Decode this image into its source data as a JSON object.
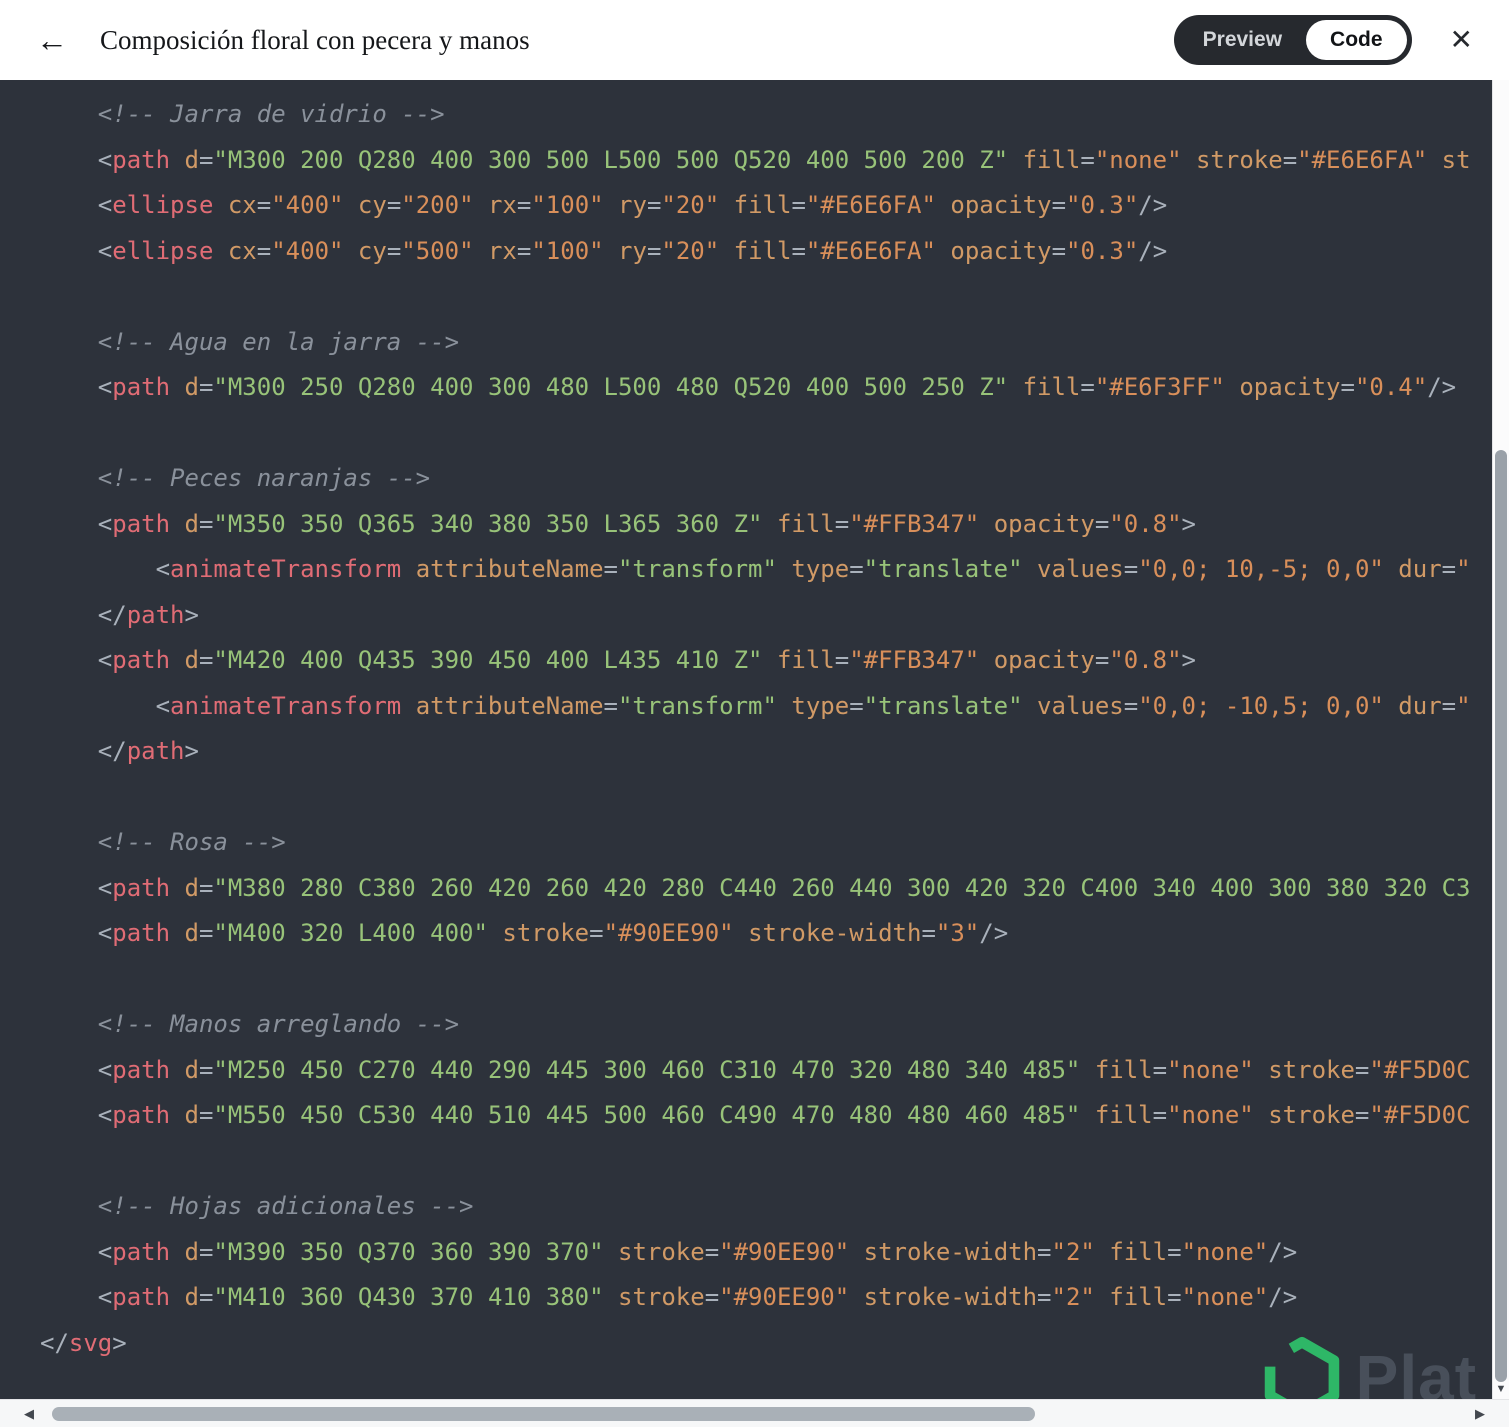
{
  "header": {
    "title": "Composición floral con pecera y manos",
    "toggle": {
      "preview_label": "Preview",
      "code_label": "Code",
      "selected": "Code"
    }
  },
  "icons": {
    "back": "←",
    "close": "✕",
    "scroll_left": "◀",
    "scroll_right": "▶",
    "scroll_down": "▼"
  },
  "watermark": {
    "text": "Plat",
    "logo_color": "#2fcf6f"
  },
  "colors": {
    "code_background": "#2d323b",
    "tag": "#e06c75",
    "attribute": "#d19a66",
    "string": "#98c379",
    "number_string": "#d98f5a",
    "comment": "#8a919b",
    "punctuation": "#a9b1bb",
    "toggle_pill": "#26292e",
    "toggle_active": "#ffffff"
  },
  "code": {
    "language": "svg",
    "token_types": {
      "c": "comment",
      "p": "punctuation",
      "t": "tag",
      "a": "attribute",
      "s": "string",
      "n": "numeric-string",
      "w": "whitespace"
    },
    "lines": [
      [
        [
          "c",
          "    <!-- Jarra de vidrio -->"
        ]
      ],
      [
        [
          "p",
          "    <"
        ],
        [
          "t",
          "path"
        ],
        [
          "w",
          " "
        ],
        [
          "a",
          "d"
        ],
        [
          "p",
          "="
        ],
        [
          "s",
          "\"M300 200 Q280 400 300 500 L500 500 Q520 400 500 200 Z\""
        ],
        [
          "w",
          " "
        ],
        [
          "a",
          "fill"
        ],
        [
          "p",
          "="
        ],
        [
          "n",
          "\"none\""
        ],
        [
          "w",
          " "
        ],
        [
          "a",
          "stroke"
        ],
        [
          "p",
          "="
        ],
        [
          "n",
          "\"#E6E6FA\""
        ],
        [
          "w",
          " "
        ],
        [
          "a",
          "st"
        ]
      ],
      [
        [
          "p",
          "    <"
        ],
        [
          "t",
          "ellipse"
        ],
        [
          "w",
          " "
        ],
        [
          "a",
          "cx"
        ],
        [
          "p",
          "="
        ],
        [
          "n",
          "\"400\""
        ],
        [
          "w",
          " "
        ],
        [
          "a",
          "cy"
        ],
        [
          "p",
          "="
        ],
        [
          "n",
          "\"200\""
        ],
        [
          "w",
          " "
        ],
        [
          "a",
          "rx"
        ],
        [
          "p",
          "="
        ],
        [
          "n",
          "\"100\""
        ],
        [
          "w",
          " "
        ],
        [
          "a",
          "ry"
        ],
        [
          "p",
          "="
        ],
        [
          "n",
          "\"20\""
        ],
        [
          "w",
          " "
        ],
        [
          "a",
          "fill"
        ],
        [
          "p",
          "="
        ],
        [
          "n",
          "\"#E6E6FA\""
        ],
        [
          "w",
          " "
        ],
        [
          "a",
          "opacity"
        ],
        [
          "p",
          "="
        ],
        [
          "n",
          "\"0.3\""
        ],
        [
          "p",
          "/>"
        ]
      ],
      [
        [
          "p",
          "    <"
        ],
        [
          "t",
          "ellipse"
        ],
        [
          "w",
          " "
        ],
        [
          "a",
          "cx"
        ],
        [
          "p",
          "="
        ],
        [
          "n",
          "\"400\""
        ],
        [
          "w",
          " "
        ],
        [
          "a",
          "cy"
        ],
        [
          "p",
          "="
        ],
        [
          "n",
          "\"500\""
        ],
        [
          "w",
          " "
        ],
        [
          "a",
          "rx"
        ],
        [
          "p",
          "="
        ],
        [
          "n",
          "\"100\""
        ],
        [
          "w",
          " "
        ],
        [
          "a",
          "ry"
        ],
        [
          "p",
          "="
        ],
        [
          "n",
          "\"20\""
        ],
        [
          "w",
          " "
        ],
        [
          "a",
          "fill"
        ],
        [
          "p",
          "="
        ],
        [
          "n",
          "\"#E6E6FA\""
        ],
        [
          "w",
          " "
        ],
        [
          "a",
          "opacity"
        ],
        [
          "p",
          "="
        ],
        [
          "n",
          "\"0.3\""
        ],
        [
          "p",
          "/>"
        ]
      ],
      [],
      [
        [
          "c",
          "    <!-- Agua en la jarra -->"
        ]
      ],
      [
        [
          "p",
          "    <"
        ],
        [
          "t",
          "path"
        ],
        [
          "w",
          " "
        ],
        [
          "a",
          "d"
        ],
        [
          "p",
          "="
        ],
        [
          "s",
          "\"M300 250 Q280 400 300 480 L500 480 Q520 400 500 250 Z\""
        ],
        [
          "w",
          " "
        ],
        [
          "a",
          "fill"
        ],
        [
          "p",
          "="
        ],
        [
          "n",
          "\"#E6F3FF\""
        ],
        [
          "w",
          " "
        ],
        [
          "a",
          "opacity"
        ],
        [
          "p",
          "="
        ],
        [
          "n",
          "\"0.4\""
        ],
        [
          "p",
          "/>"
        ]
      ],
      [],
      [
        [
          "c",
          "    <!-- Peces naranjas -->"
        ]
      ],
      [
        [
          "p",
          "    <"
        ],
        [
          "t",
          "path"
        ],
        [
          "w",
          " "
        ],
        [
          "a",
          "d"
        ],
        [
          "p",
          "="
        ],
        [
          "s",
          "\"M350 350 Q365 340 380 350 L365 360 Z\""
        ],
        [
          "w",
          " "
        ],
        [
          "a",
          "fill"
        ],
        [
          "p",
          "="
        ],
        [
          "n",
          "\"#FFB347\""
        ],
        [
          "w",
          " "
        ],
        [
          "a",
          "opacity"
        ],
        [
          "p",
          "="
        ],
        [
          "n",
          "\"0.8\""
        ],
        [
          "p",
          ">"
        ]
      ],
      [
        [
          "p",
          "        <"
        ],
        [
          "t",
          "animateTransform"
        ],
        [
          "w",
          " "
        ],
        [
          "a",
          "attributeName"
        ],
        [
          "p",
          "="
        ],
        [
          "s",
          "\"transform\""
        ],
        [
          "w",
          " "
        ],
        [
          "a",
          "type"
        ],
        [
          "p",
          "="
        ],
        [
          "s",
          "\"translate\""
        ],
        [
          "w",
          " "
        ],
        [
          "a",
          "values"
        ],
        [
          "p",
          "="
        ],
        [
          "n",
          "\"0,0; 10,-5; 0,0\""
        ],
        [
          "w",
          " "
        ],
        [
          "a",
          "dur"
        ],
        [
          "p",
          "="
        ],
        [
          "n",
          "\""
        ]
      ],
      [
        [
          "p",
          "    </"
        ],
        [
          "t",
          "path"
        ],
        [
          "p",
          ">"
        ]
      ],
      [
        [
          "p",
          "    <"
        ],
        [
          "t",
          "path"
        ],
        [
          "w",
          " "
        ],
        [
          "a",
          "d"
        ],
        [
          "p",
          "="
        ],
        [
          "s",
          "\"M420 400 Q435 390 450 400 L435 410 Z\""
        ],
        [
          "w",
          " "
        ],
        [
          "a",
          "fill"
        ],
        [
          "p",
          "="
        ],
        [
          "n",
          "\"#FFB347\""
        ],
        [
          "w",
          " "
        ],
        [
          "a",
          "opacity"
        ],
        [
          "p",
          "="
        ],
        [
          "n",
          "\"0.8\""
        ],
        [
          "p",
          ">"
        ]
      ],
      [
        [
          "p",
          "        <"
        ],
        [
          "t",
          "animateTransform"
        ],
        [
          "w",
          " "
        ],
        [
          "a",
          "attributeName"
        ],
        [
          "p",
          "="
        ],
        [
          "s",
          "\"transform\""
        ],
        [
          "w",
          " "
        ],
        [
          "a",
          "type"
        ],
        [
          "p",
          "="
        ],
        [
          "s",
          "\"translate\""
        ],
        [
          "w",
          " "
        ],
        [
          "a",
          "values"
        ],
        [
          "p",
          "="
        ],
        [
          "n",
          "\"0,0; -10,5; 0,0\""
        ],
        [
          "w",
          " "
        ],
        [
          "a",
          "dur"
        ],
        [
          "p",
          "="
        ],
        [
          "n",
          "\""
        ]
      ],
      [
        [
          "p",
          "    </"
        ],
        [
          "t",
          "path"
        ],
        [
          "p",
          ">"
        ]
      ],
      [],
      [
        [
          "c",
          "    <!-- Rosa -->"
        ]
      ],
      [
        [
          "p",
          "    <"
        ],
        [
          "t",
          "path"
        ],
        [
          "w",
          " "
        ],
        [
          "a",
          "d"
        ],
        [
          "p",
          "="
        ],
        [
          "s",
          "\"M380 280 C380 260 420 260 420 280 C440 260 440 300 420 320 C400 340 400 300 380 320 C3"
        ]
      ],
      [
        [
          "p",
          "    <"
        ],
        [
          "t",
          "path"
        ],
        [
          "w",
          " "
        ],
        [
          "a",
          "d"
        ],
        [
          "p",
          "="
        ],
        [
          "s",
          "\"M400 320 L400 400\""
        ],
        [
          "w",
          " "
        ],
        [
          "a",
          "stroke"
        ],
        [
          "p",
          "="
        ],
        [
          "n",
          "\"#90EE90\""
        ],
        [
          "w",
          " "
        ],
        [
          "a",
          "stroke-width"
        ],
        [
          "p",
          "="
        ],
        [
          "n",
          "\"3\""
        ],
        [
          "p",
          "/>"
        ]
      ],
      [],
      [
        [
          "c",
          "    <!-- Manos arreglando -->"
        ]
      ],
      [
        [
          "p",
          "    <"
        ],
        [
          "t",
          "path"
        ],
        [
          "w",
          " "
        ],
        [
          "a",
          "d"
        ],
        [
          "p",
          "="
        ],
        [
          "s",
          "\"M250 450 C270 440 290 445 300 460 C310 470 320 480 340 485\""
        ],
        [
          "w",
          " "
        ],
        [
          "a",
          "fill"
        ],
        [
          "p",
          "="
        ],
        [
          "n",
          "\"none\""
        ],
        [
          "w",
          " "
        ],
        [
          "a",
          "stroke"
        ],
        [
          "p",
          "="
        ],
        [
          "n",
          "\"#F5D0C"
        ]
      ],
      [
        [
          "p",
          "    <"
        ],
        [
          "t",
          "path"
        ],
        [
          "w",
          " "
        ],
        [
          "a",
          "d"
        ],
        [
          "p",
          "="
        ],
        [
          "s",
          "\"M550 450 C530 440 510 445 500 460 C490 470 480 480 460 485\""
        ],
        [
          "w",
          " "
        ],
        [
          "a",
          "fill"
        ],
        [
          "p",
          "="
        ],
        [
          "n",
          "\"none\""
        ],
        [
          "w",
          " "
        ],
        [
          "a",
          "stroke"
        ],
        [
          "p",
          "="
        ],
        [
          "n",
          "\"#F5D0C"
        ]
      ],
      [],
      [
        [
          "c",
          "    <!-- Hojas adicionales -->"
        ]
      ],
      [
        [
          "p",
          "    <"
        ],
        [
          "t",
          "path"
        ],
        [
          "w",
          " "
        ],
        [
          "a",
          "d"
        ],
        [
          "p",
          "="
        ],
        [
          "s",
          "\"M390 350 Q370 360 390 370\""
        ],
        [
          "w",
          " "
        ],
        [
          "a",
          "stroke"
        ],
        [
          "p",
          "="
        ],
        [
          "n",
          "\"#90EE90\""
        ],
        [
          "w",
          " "
        ],
        [
          "a",
          "stroke-width"
        ],
        [
          "p",
          "="
        ],
        [
          "n",
          "\"2\""
        ],
        [
          "w",
          " "
        ],
        [
          "a",
          "fill"
        ],
        [
          "p",
          "="
        ],
        [
          "n",
          "\"none\""
        ],
        [
          "p",
          "/>"
        ]
      ],
      [
        [
          "p",
          "    <"
        ],
        [
          "t",
          "path"
        ],
        [
          "w",
          " "
        ],
        [
          "a",
          "d"
        ],
        [
          "p",
          "="
        ],
        [
          "s",
          "\"M410 360 Q430 370 410 380\""
        ],
        [
          "w",
          " "
        ],
        [
          "a",
          "stroke"
        ],
        [
          "p",
          "="
        ],
        [
          "n",
          "\"#90EE90\""
        ],
        [
          "w",
          " "
        ],
        [
          "a",
          "stroke-width"
        ],
        [
          "p",
          "="
        ],
        [
          "n",
          "\"2\""
        ],
        [
          "w",
          " "
        ],
        [
          "a",
          "fill"
        ],
        [
          "p",
          "="
        ],
        [
          "n",
          "\"none\""
        ],
        [
          "p",
          "/>"
        ]
      ],
      [
        [
          "p",
          "</"
        ],
        [
          "t",
          "svg"
        ],
        [
          "p",
          ">"
        ]
      ]
    ]
  }
}
